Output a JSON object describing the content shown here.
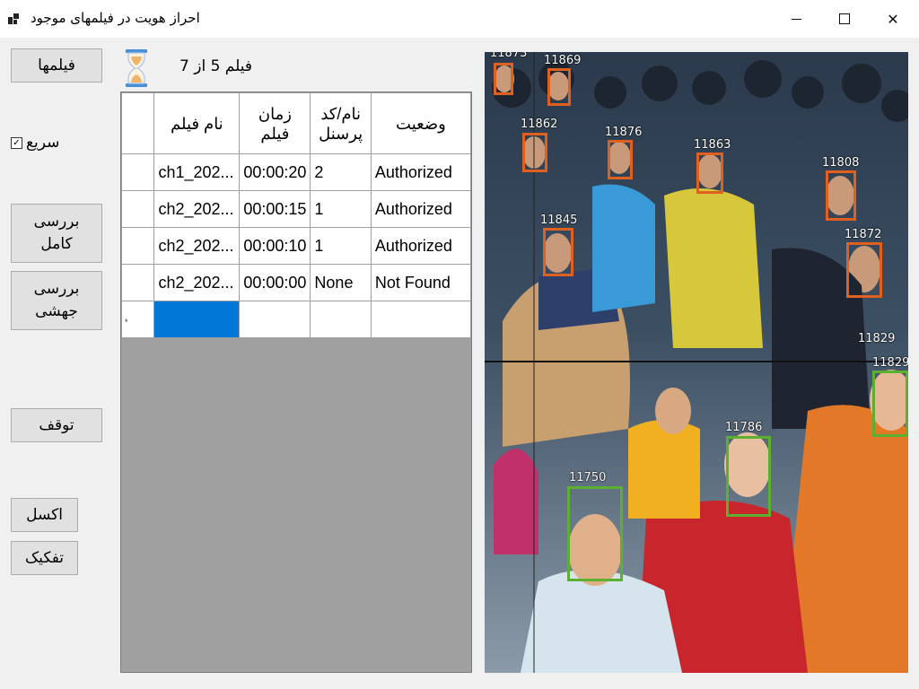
{
  "window": {
    "title": "احراز هویت در فیلمهای موجود"
  },
  "sidebar": {
    "films_button": "فیلمها",
    "fast_checkbox_label": "سریع",
    "fast_checked": true,
    "full_check_button": "بررسی\nکامل",
    "directional_check_button": "بررسی\nجهشی",
    "stop_button": "توقف",
    "excel_button": "اکسل",
    "separate_button": "تفکیک"
  },
  "status": {
    "film_count": "فیلم 5 از 7"
  },
  "grid": {
    "columns": [
      "نام فیلم",
      "زمان فیلم",
      "نام/کد پرسنل",
      "وضعیت"
    ],
    "rows": [
      {
        "film": "ch1_202...",
        "time": "00:00:20",
        "person": "2",
        "status": "Authorized"
      },
      {
        "film": "ch2_202...",
        "time": "00:00:15",
        "person": "1",
        "status": "Authorized"
      },
      {
        "film": "ch2_202...",
        "time": "00:00:10",
        "person": "1",
        "status": "Authorized"
      },
      {
        "film": "ch2_202...",
        "time": "00:00:00",
        "person": "None",
        "status": "Not Found"
      }
    ],
    "new_row_marker": "*"
  },
  "video": {
    "face_labels": [
      "11873",
      "11869",
      "11862",
      "11876",
      "11863",
      "11808",
      "11845",
      "11872",
      "11829",
      "11829",
      "11786",
      "11750"
    ],
    "colors": {
      "unauthorized": "#e06020",
      "authorized": "#5cb030"
    }
  }
}
